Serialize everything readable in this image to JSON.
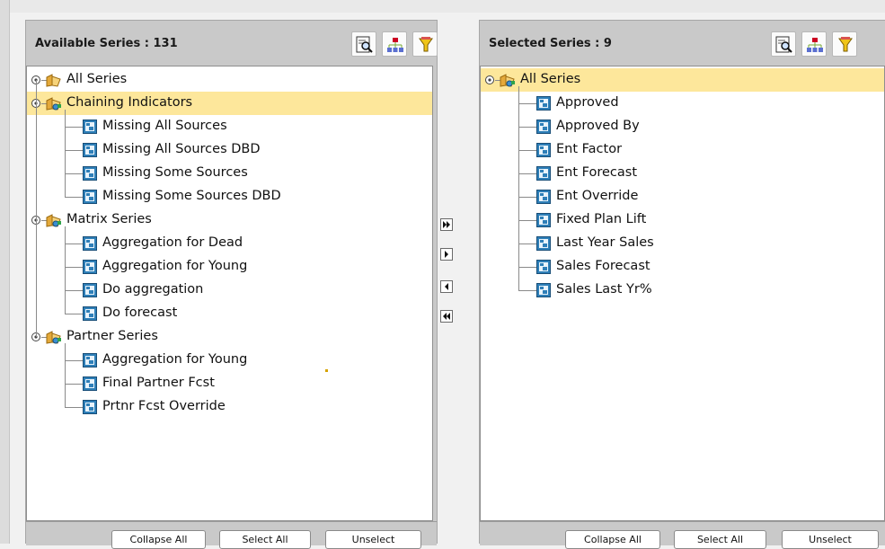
{
  "left_panel": {
    "title": "Available Series : 131",
    "tree": [
      {
        "label": "All Series",
        "kind": "root"
      },
      {
        "label": "Chaining Indicators",
        "kind": "folder",
        "selected": true
      },
      {
        "label": "Missing All Sources",
        "kind": "series"
      },
      {
        "label": "Missing All Sources DBD",
        "kind": "series"
      },
      {
        "label": "Missing Some Sources",
        "kind": "series"
      },
      {
        "label": "Missing Some Sources DBD",
        "kind": "series"
      },
      {
        "label": "Matrix Series",
        "kind": "folder"
      },
      {
        "label": "Aggregation for Dead",
        "kind": "series"
      },
      {
        "label": "Aggregation for Young",
        "kind": "series"
      },
      {
        "label": "Do aggregation",
        "kind": "series"
      },
      {
        "label": "Do forecast",
        "kind": "series"
      },
      {
        "label": "Partner Series",
        "kind": "folder"
      },
      {
        "label": "Aggregation for Young",
        "kind": "series"
      },
      {
        "label": "Final Partner Fcst",
        "kind": "series"
      },
      {
        "label": "Prtnr Fcst Override",
        "kind": "series"
      }
    ],
    "buttons": {
      "collapse": "Collapse All",
      "select": "Select All",
      "unselect": "Unselect"
    }
  },
  "right_panel": {
    "title": "Selected Series : 9",
    "tree": [
      {
        "label": "All Series",
        "kind": "folder",
        "selected": true
      },
      {
        "label": "Approved",
        "kind": "series"
      },
      {
        "label": "Approved By",
        "kind": "series"
      },
      {
        "label": "Ent Factor",
        "kind": "series"
      },
      {
        "label": "Ent Forecast",
        "kind": "series"
      },
      {
        "label": "Ent Override",
        "kind": "series"
      },
      {
        "label": "Fixed Plan Lift",
        "kind": "series"
      },
      {
        "label": "Last Year Sales",
        "kind": "series"
      },
      {
        "label": "Sales Forecast",
        "kind": "series"
      },
      {
        "label": "Sales Last Yr%",
        "kind": "series"
      }
    ],
    "buttons": {
      "collapse": "Collapse All",
      "select": "Select All",
      "unselect": "Unselect"
    }
  },
  "header_icons": [
    "search-icon",
    "hierarchy-icon",
    "filter-icon"
  ],
  "mover_icons": [
    "move-all-right-icon",
    "move-right-icon",
    "move-left-icon",
    "move-all-left-icon"
  ],
  "colors": {
    "selection": "#fde79b",
    "panel": "#c9c9c9",
    "series_icon": "#2e7fb8",
    "folder": "#f2c15a"
  }
}
